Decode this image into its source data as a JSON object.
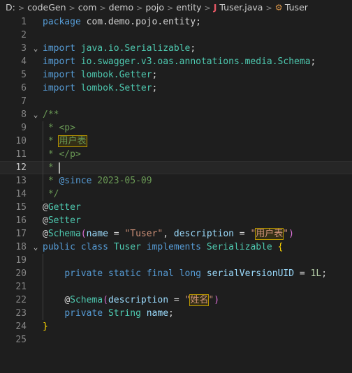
{
  "breadcrumb": {
    "segments": [
      "D:",
      "codeGen",
      "com",
      "demo",
      "pojo",
      "entity"
    ],
    "file_icon": "J",
    "file": "Tuser.java",
    "symbol_icon": "class-icon",
    "symbol": "Tuser"
  },
  "editor": {
    "language": "java",
    "current_line": 12,
    "line_numbers": [
      "1",
      "2",
      "3",
      "4",
      "5",
      "6",
      "7",
      "8",
      "9",
      "10",
      "11",
      "12",
      "13",
      "14",
      "15",
      "16",
      "17",
      "18",
      "19",
      "20",
      "21",
      "22",
      "23",
      "24",
      "25"
    ],
    "text": {
      "package_kw": "package",
      "package_name": "com.demo.pojo.entity",
      "import_kw": "import",
      "import_1": "java.io.Serializable",
      "import_2": "io.swagger.v3.oas.annotations.media.Schema",
      "import_3": "lombok.Getter",
      "import_4": "lombok.Setter",
      "doc_open": "/**",
      "doc_star": " * ",
      "p_open": "<p>",
      "table_name": "用户表",
      "p_close": "</p>",
      "since_tag": "@since",
      "since_date": "2023-05-09",
      "doc_close": " */",
      "getter": "Getter",
      "setter": "Setter",
      "schema": "Schema",
      "name_attr": "name",
      "class_name_str": "\"Tuser\"",
      "description_attr": "description",
      "table_desc": "用户表",
      "public_kw": "public",
      "class_kw": "class",
      "class_name": "Tuser",
      "implements_kw": "implements",
      "serializable": "Serializable",
      "private_kw": "private",
      "static_kw": "static",
      "final_kw": "final",
      "long_kw": "long",
      "serial_field": "serialVersionUID",
      "serial_value": "1L",
      "field_desc": "姓名",
      "string_type": "String",
      "field_name": "name"
    }
  }
}
